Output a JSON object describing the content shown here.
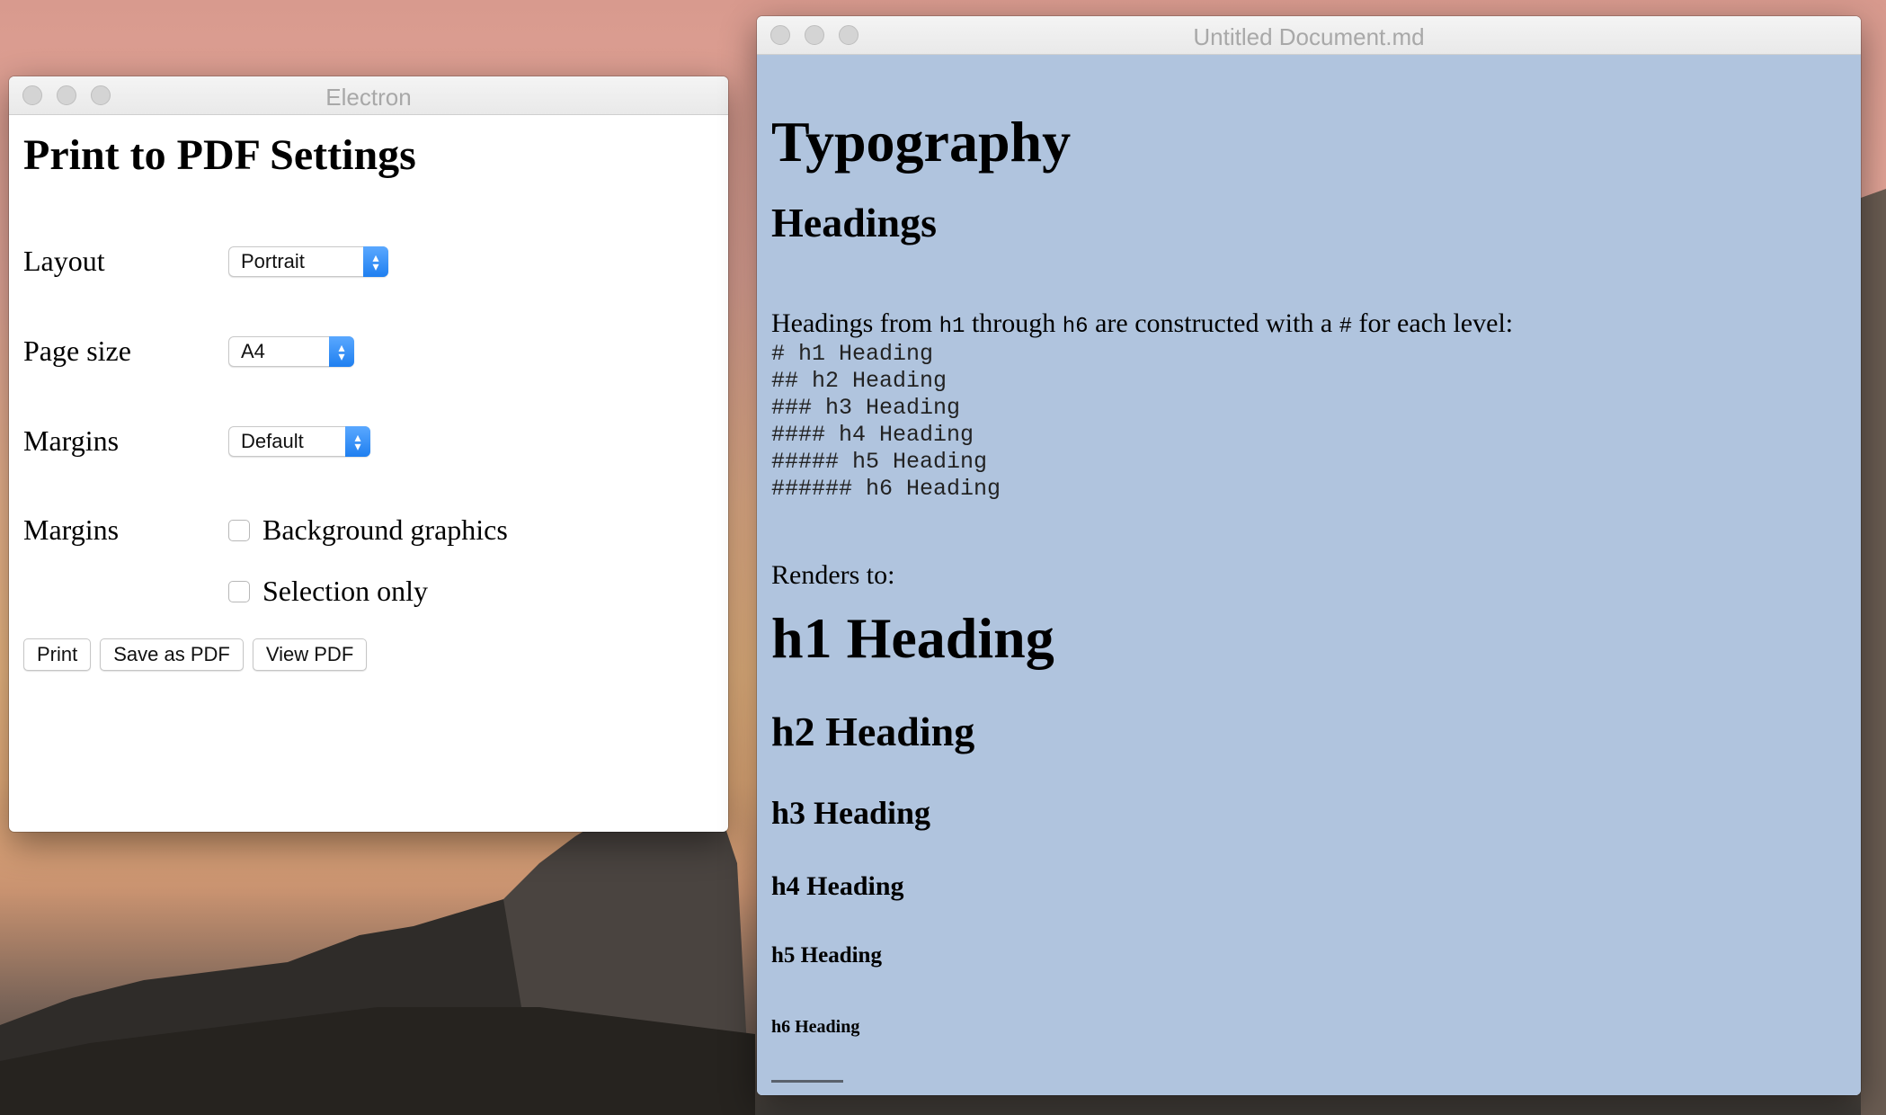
{
  "settings_window": {
    "title": "Electron",
    "heading": "Print to PDF Settings",
    "rows": [
      {
        "label": "Layout",
        "value": "Portrait"
      },
      {
        "label": "Page size",
        "value": "A4"
      },
      {
        "label": "Margins",
        "value": "Default"
      }
    ],
    "options_label": "Margins",
    "options": [
      {
        "label": "Background graphics",
        "checked": false
      },
      {
        "label": "Selection only",
        "checked": false
      }
    ],
    "buttons": {
      "print": "Print",
      "save_pdf": "Save as PDF",
      "view_pdf": "View PDF"
    }
  },
  "document_window": {
    "title": "Untitled Document.md",
    "background": "#b0c4de",
    "h1": "Typography",
    "h2": "Headings",
    "para": {
      "part1": "Headings from ",
      "code1": "h1",
      "part2": " through ",
      "code2": "h6",
      "part3": " are constructed with a ",
      "code3": "#",
      "part4": " for each level:"
    },
    "code_lines": [
      "# h1 Heading",
      "## h2 Heading",
      "### h3 Heading",
      "#### h4 Heading",
      "##### h5 Heading",
      "###### h6 Heading"
    ],
    "renders_to": "Renders to:",
    "headings": [
      "h1 Heading",
      "h2 Heading",
      "h3 Heading",
      "h4 Heading",
      "h5 Heading",
      "h6 Heading"
    ]
  }
}
